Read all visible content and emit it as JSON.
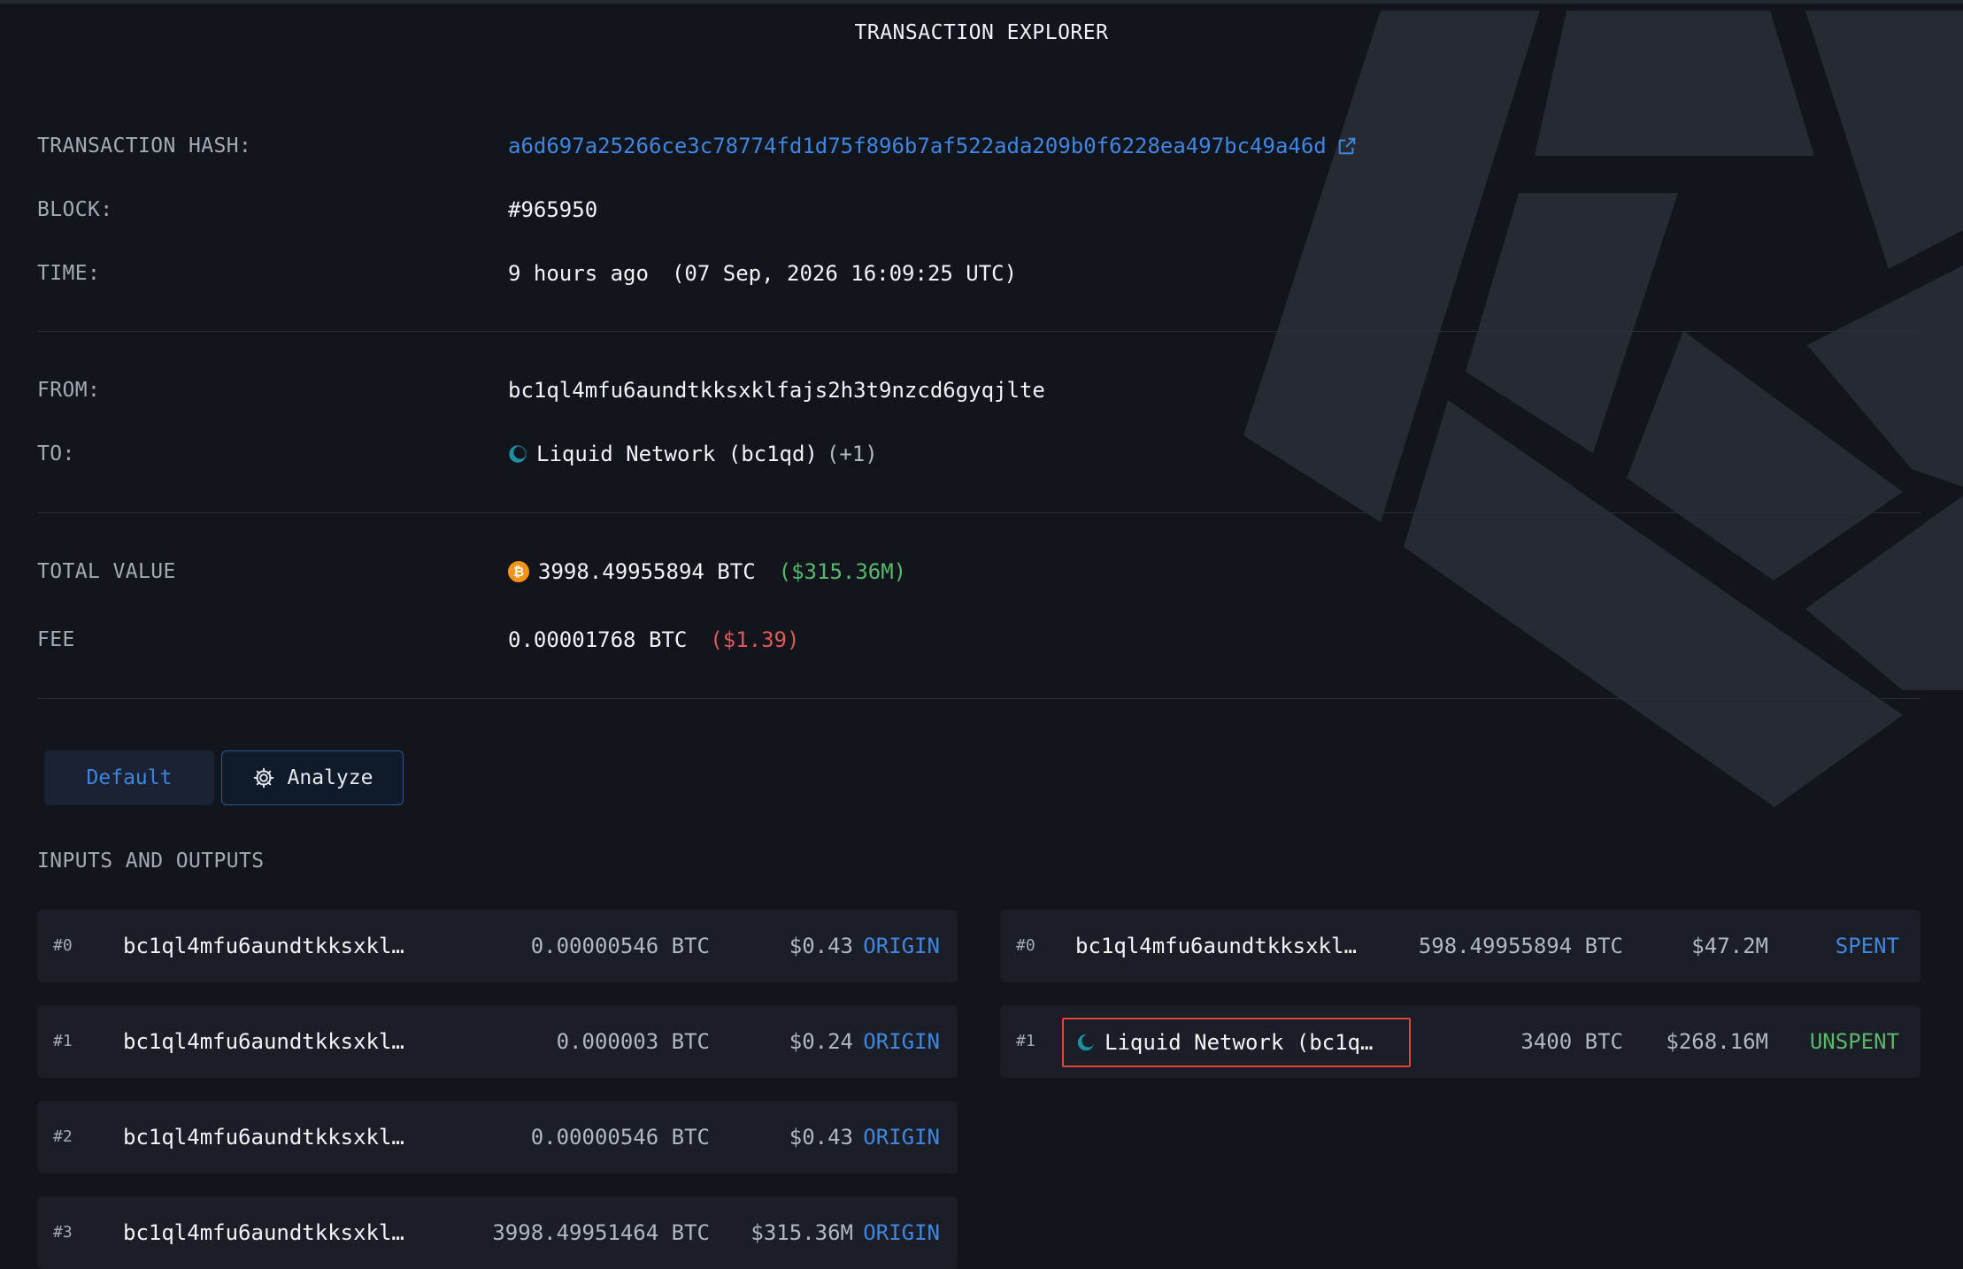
{
  "header": {
    "title": "TRANSACTION EXPLORER"
  },
  "details": {
    "hash_label": "TRANSACTION HASH:",
    "hash_value": "a6d697a25266ce3c78774fd1d75f896b7af522ada209b0f6228ea497bc49a46d",
    "block_label": "BLOCK:",
    "block_value": "#965950",
    "time_label": "TIME:",
    "time_relative": "9 hours ago",
    "time_absolute": "(07 Sep, 2026 16:09:25 UTC)",
    "from_label": "FROM:",
    "from_value": "bc1ql4mfu6aundtkksxklfajs2h3t9nzcd6gyqjlte",
    "to_label": "TO:",
    "to_value": "Liquid Network (bc1qd)",
    "to_extra": "(+1)",
    "total_label": "TOTAL VALUE",
    "total_btc": "3998.49955894 BTC",
    "total_usd": "($315.36M)",
    "fee_label": "FEE",
    "fee_btc": "0.00001768 BTC",
    "fee_usd": "($1.39)"
  },
  "tabs": {
    "default_label": "Default",
    "analyze_label": "Analyze"
  },
  "io": {
    "title": "INPUTS AND OUTPUTS",
    "inputs": [
      {
        "index": "#0",
        "address": "bc1ql4mfu6aundtkksxkl…",
        "amount": "0.00000546 BTC",
        "usd": "$0.43",
        "status": "ORIGIN"
      },
      {
        "index": "#1",
        "address": "bc1ql4mfu6aundtkksxkl…",
        "amount": "0.000003 BTC",
        "usd": "$0.24",
        "status": "ORIGIN"
      },
      {
        "index": "#2",
        "address": "bc1ql4mfu6aundtkksxkl…",
        "amount": "0.00000546 BTC",
        "usd": "$0.43",
        "status": "ORIGIN"
      },
      {
        "index": "#3",
        "address": "bc1ql4mfu6aundtkksxkl…",
        "amount": "3998.49951464 BTC",
        "usd": "$315.36M",
        "status": "ORIGIN"
      }
    ],
    "outputs": [
      {
        "index": "#0",
        "address": "bc1ql4mfu6aundtkksxklf…",
        "amount": "598.49955894 BTC",
        "usd": "$47.2M",
        "status": "SPENT"
      },
      {
        "index": "#1",
        "address": "Liquid Network (bc1q…",
        "amount": "3400 BTC",
        "usd": "$268.16M",
        "status": "UNSPENT"
      }
    ]
  },
  "icons": {
    "external_link": "external-link-icon",
    "liquid_network": "liquid-network-icon",
    "bitcoin": "bitcoin-icon",
    "analyze": "gear-icon"
  },
  "colors": {
    "background": "#13151c",
    "accent_blue": "#3f86e0",
    "positive_green": "#58b86c",
    "negative_red": "#e05a57",
    "highlight_red": "#e0413e",
    "bitcoin_orange": "#f7931a",
    "row_bg": "#1b1e26"
  }
}
